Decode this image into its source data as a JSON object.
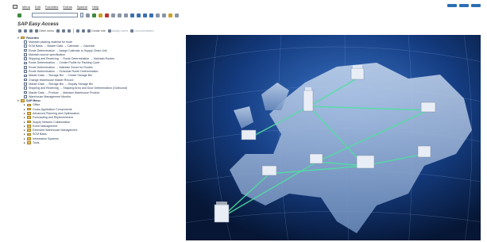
{
  "menu": {
    "items": [
      "Menu",
      "Edit",
      "Favorites",
      "Extras",
      "System",
      "Help"
    ]
  },
  "title": "SAP Easy Access",
  "app_toolbar": {
    "other_menu": "Other menu",
    "create_role": "Create role",
    "assign_users": "Assign users",
    "docu": "Documentation"
  },
  "tree": {
    "favorites_label": "Favorites",
    "favorites": [
      "Maintain packing material for route",
      "SCM Basis → Master Data → Calendar → Calendar",
      "Route Determination → Assign Calendar to Supply Chain Unit",
      "Maintain source specification",
      "Shipping and Receiving → Route Determination → Maintain Routes",
      "Route Determination → Create Profile for Packing Cycle",
      "Route Determination → Maintain Zones for Routes",
      "Route Determination → Schedule Route Determination",
      "Master Data → Storage Bin → Create Storage Bin",
      "Change Warehouse Master Record",
      "Master Data → Storage Bin → Display Storage Bin",
      "Shipping and Receiving → Shipping Area and Door Determination (Outbound)",
      "Master Data → Product → Maintain Warehouse Product",
      "Warehouse Management Monitor"
    ],
    "sap_menu_label": "SAP Menu",
    "sap_menu": [
      "Office",
      "Cross-Application Components",
      "Advanced Planning and Optimization",
      "Forecasting and Replenishment",
      "Supply Network Collaboration",
      "Event Management",
      "Extended Warehouse Management",
      "SCM Basis",
      "Information Systems",
      "Tools"
    ]
  },
  "colors": {
    "accent": "#2b6fb3",
    "tree_text": "#2a3a55",
    "folder": "#e6c35a",
    "map_bg": "#0a1f4a",
    "connection": "#4fe0a0"
  }
}
